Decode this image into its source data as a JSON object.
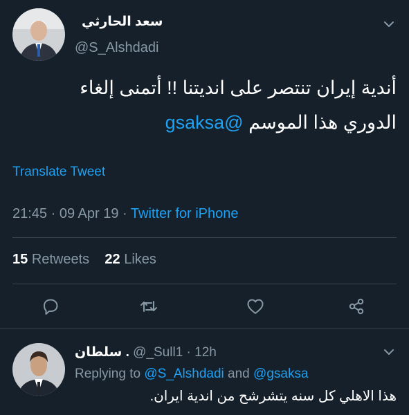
{
  "tweet": {
    "display_name": "سعد الحارثي",
    "handle": "@S_Alshdadi",
    "text_line1": "أندية إيران تنتصر على انديتنا !! أتمنى إلغاء",
    "text_line2_prefix": "الدوري هذا الموسم ",
    "text_mention": "@gsaksa",
    "translate_label": "Translate Tweet",
    "time": "21:45",
    "date": "09 Apr 19",
    "source": "Twitter for iPhone",
    "retweets_count": "15",
    "retweets_label": "Retweets",
    "likes_count": "22",
    "likes_label": "Likes"
  },
  "actions": {
    "reply_icon": "reply-icon",
    "retweet_icon": "retweet-icon",
    "like_icon": "heart-icon",
    "share_icon": "share-icon"
  },
  "reply": {
    "display_name": "سلطان .",
    "handle": "@_Sull1",
    "time": "12h",
    "replying_prefix": "Replying to",
    "replying_user1": "@S_Alshdadi",
    "replying_and": "and",
    "replying_user2": "@gsaksa",
    "text": "هذا الاهلي كل سنه يتشرشح من اندية ايران."
  },
  "colors": {
    "background": "#15202b",
    "accent": "#1da1f2",
    "secondary_text": "#8899a6",
    "divider": "#38444d"
  }
}
